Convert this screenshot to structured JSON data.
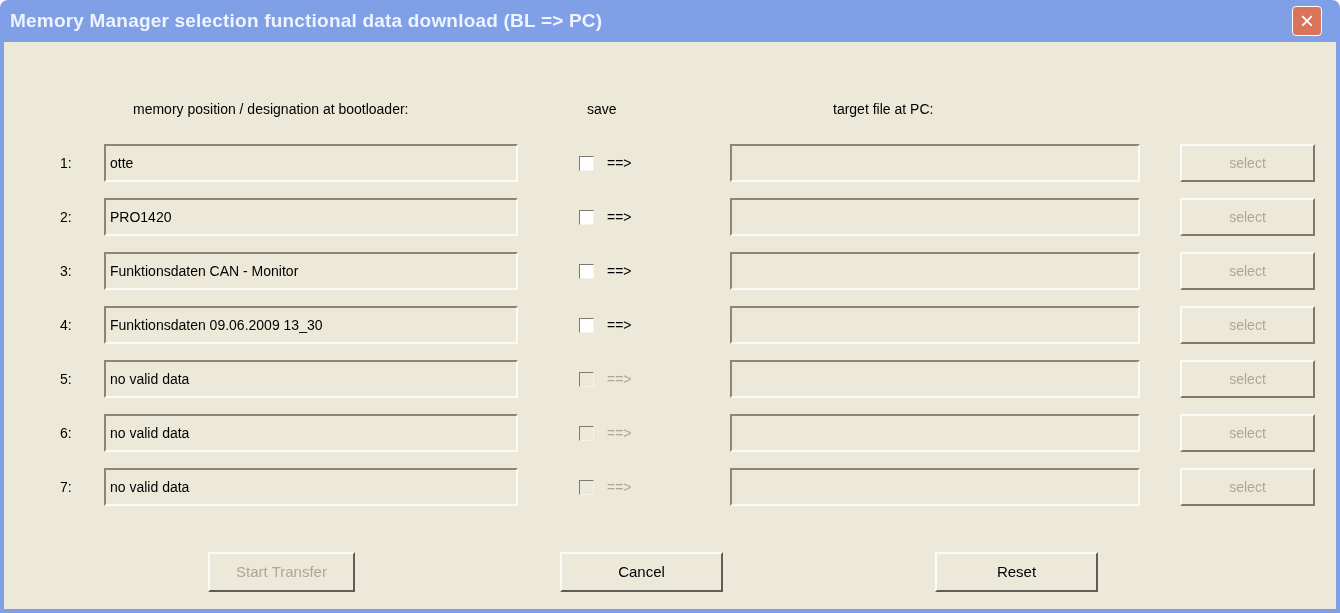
{
  "window": {
    "title": "Memory Manager selection functional data download (BL => PC)",
    "close": "×"
  },
  "headers": {
    "designation": "memory position / designation at bootloader:",
    "save": "save",
    "target": "target file at PC:"
  },
  "rows": [
    {
      "number": "1:",
      "designation": "otte",
      "checked": false,
      "disabled": false,
      "arrow": "==>",
      "select": "select",
      "select_disabled": true
    },
    {
      "number": "2:",
      "designation": "PRO1420",
      "checked": false,
      "disabled": false,
      "arrow": "==>",
      "select": "select",
      "select_disabled": true
    },
    {
      "number": "3:",
      "designation": "Funktionsdaten CAN - Monitor",
      "checked": false,
      "disabled": false,
      "arrow": "==>",
      "select": "select",
      "select_disabled": true
    },
    {
      "number": "4:",
      "designation": "Funktionsdaten 09.06.2009 13_30",
      "checked": false,
      "disabled": false,
      "arrow": "==>",
      "select": "select",
      "select_disabled": true
    },
    {
      "number": "5:",
      "designation": "no valid data",
      "checked": false,
      "disabled": true,
      "arrow": "==>",
      "select": "select",
      "select_disabled": true
    },
    {
      "number": "6:",
      "designation": "no valid data",
      "checked": false,
      "disabled": true,
      "arrow": "==>",
      "select": "select",
      "select_disabled": true
    },
    {
      "number": "7:",
      "designation": "no valid data",
      "checked": false,
      "disabled": true,
      "arrow": "==>",
      "select": "select",
      "select_disabled": true
    }
  ],
  "buttons": [
    {
      "label": "Start Transfer",
      "disabled": true
    },
    {
      "label": "Cancel",
      "disabled": false
    },
    {
      "label": "Reset",
      "disabled": false
    }
  ]
}
